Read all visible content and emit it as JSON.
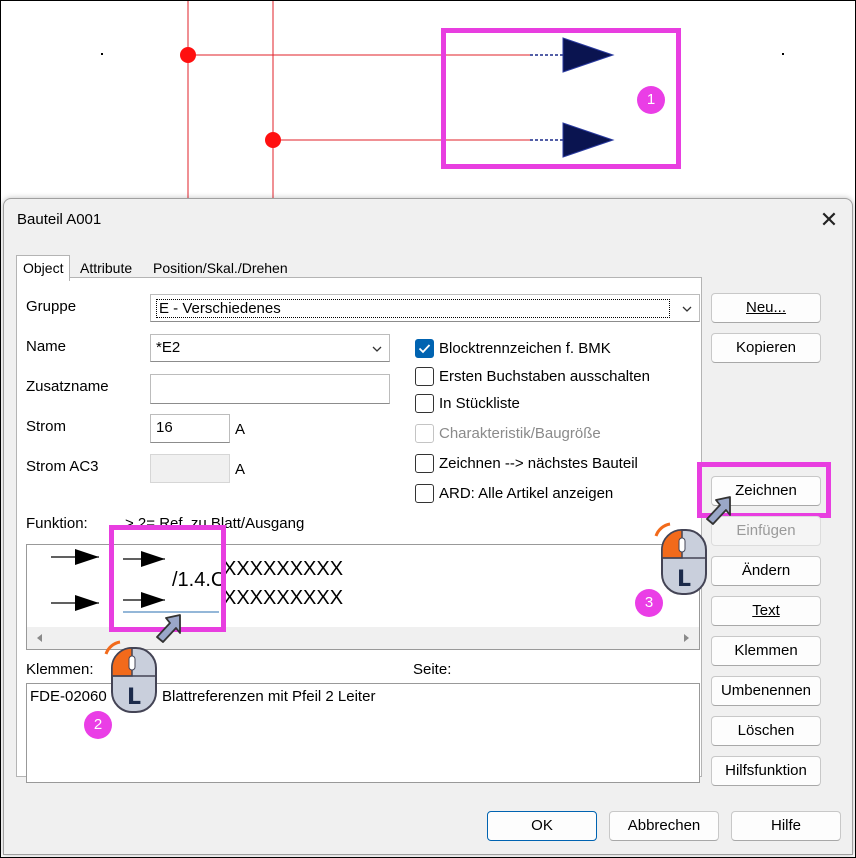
{
  "dialog": {
    "title": "Bauteil A001",
    "close_glyph": "✕",
    "tabs": [
      {
        "label": "Object",
        "active": true
      },
      {
        "label": "Attribute"
      },
      {
        "label": "Position/Skal./Drehen"
      }
    ]
  },
  "form": {
    "gruppe_label": "Gruppe",
    "gruppe_value": "E - Verschiedenes",
    "name_label": "Name",
    "name_value": "*E2",
    "zusatzname_label": "Zusatzname",
    "zusatzname_value": "",
    "strom_label": "Strom",
    "strom_value": "16",
    "strom_unit": "A",
    "stromac3_label": "Strom AC3",
    "stromac3_value": "",
    "stromac3_unit": "A"
  },
  "checkboxes": [
    {
      "label": "Blocktrennzeichen f. BMK",
      "checked": true
    },
    {
      "label": "Ersten Buchstaben ausschalten",
      "checked": false
    },
    {
      "label": "In Stückliste",
      "checked": false
    },
    {
      "label": "Charakteristik/Baugröße",
      "checked": false,
      "disabled": true
    },
    {
      "label": "Zeichnen --> nächstes Bauteil",
      "checked": false
    },
    {
      "label": "ARD: Alle Artikel anzeigen",
      "checked": false
    }
  ],
  "funktion": {
    "label": "Funktion:",
    "description": "> 2= Ref. zu Blatt/Ausgang",
    "ref_text": "/1.4.C",
    "row1_text": "XXXXXXXXX",
    "row2_text": "XXXXXXXXX"
  },
  "klemmen": {
    "label": "Klemmen:",
    "seite_label": "Seite:",
    "item_code": "FDE-02060",
    "item_desc": "Blattreferenzen mit  Pfeil  2 Leiter"
  },
  "buttons": {
    "neu": "Neu...",
    "kopieren": "Kopieren",
    "zeichnen": "Zeichnen",
    "einfuegen": "Einfügen",
    "aendern": "Ändern",
    "text": "Text",
    "klemmen": "Klemmen",
    "umbenennen": "Umbenennen",
    "loeschen": "Löschen",
    "hilfsfunktion": "Hilfsfunktion",
    "ok": "OK",
    "abbrechen": "Abbrechen",
    "hilfe": "Hilfe"
  },
  "annotations": {
    "badge1": "1",
    "badge2": "2",
    "badge3": "3",
    "mouse_letter": "L"
  },
  "colors": {
    "magenta": "#e83ee0",
    "accent": "#0063b1",
    "wire": "#e0202a",
    "arrow_fill": "#0a1450"
  }
}
